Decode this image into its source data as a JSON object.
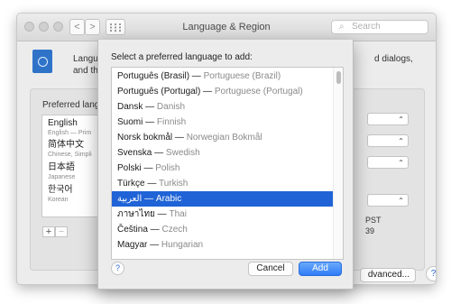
{
  "window": {
    "title": "Language & Region",
    "search_placeholder": "Search",
    "nav_back": "<",
    "nav_forward": ">",
    "grid_icon": "grid-icon",
    "description_line1": "Langua",
    "description_line2": "and the",
    "description_right": "d dialogs,",
    "preferred_label": "Preferred langu",
    "languages": [
      {
        "name": "English",
        "sub": "English — Prim"
      },
      {
        "name": "简体中文",
        "sub": "Chinese, Simpli"
      },
      {
        "name": "日本語",
        "sub": "Japanese"
      },
      {
        "name": "한국어",
        "sub": "Korean"
      }
    ],
    "plus": "+",
    "minus": "−",
    "side_text1": "PST",
    "side_text2": "39",
    "advanced_label": "dvanced...",
    "help": "?"
  },
  "sheet": {
    "title": "Select a preferred language to add:",
    "items": [
      {
        "native": "Português (Brasil)",
        "english": "Portuguese (Brazil)"
      },
      {
        "native": "Português (Portugal)",
        "english": "Portuguese (Portugal)"
      },
      {
        "native": "Dansk",
        "english": "Danish"
      },
      {
        "native": "Suomi",
        "english": "Finnish"
      },
      {
        "native": "Norsk bokmål",
        "english": "Norwegian Bokmål"
      },
      {
        "native": "Svenska",
        "english": "Swedish"
      },
      {
        "native": "Polski",
        "english": "Polish"
      },
      {
        "native": "Türkçe",
        "english": "Turkish"
      },
      {
        "native": "العربية",
        "english": "Arabic",
        "selected": true
      },
      {
        "native": "ภาษาไทย",
        "english": "Thai"
      },
      {
        "native": "Čeština",
        "english": "Czech"
      },
      {
        "native": "Magyar",
        "english": "Hungarian"
      }
    ],
    "help": "?",
    "cancel": "Cancel",
    "add": "Add"
  },
  "colors": {
    "selection": "#1f63d6",
    "add_button": "#2e7cf6"
  }
}
